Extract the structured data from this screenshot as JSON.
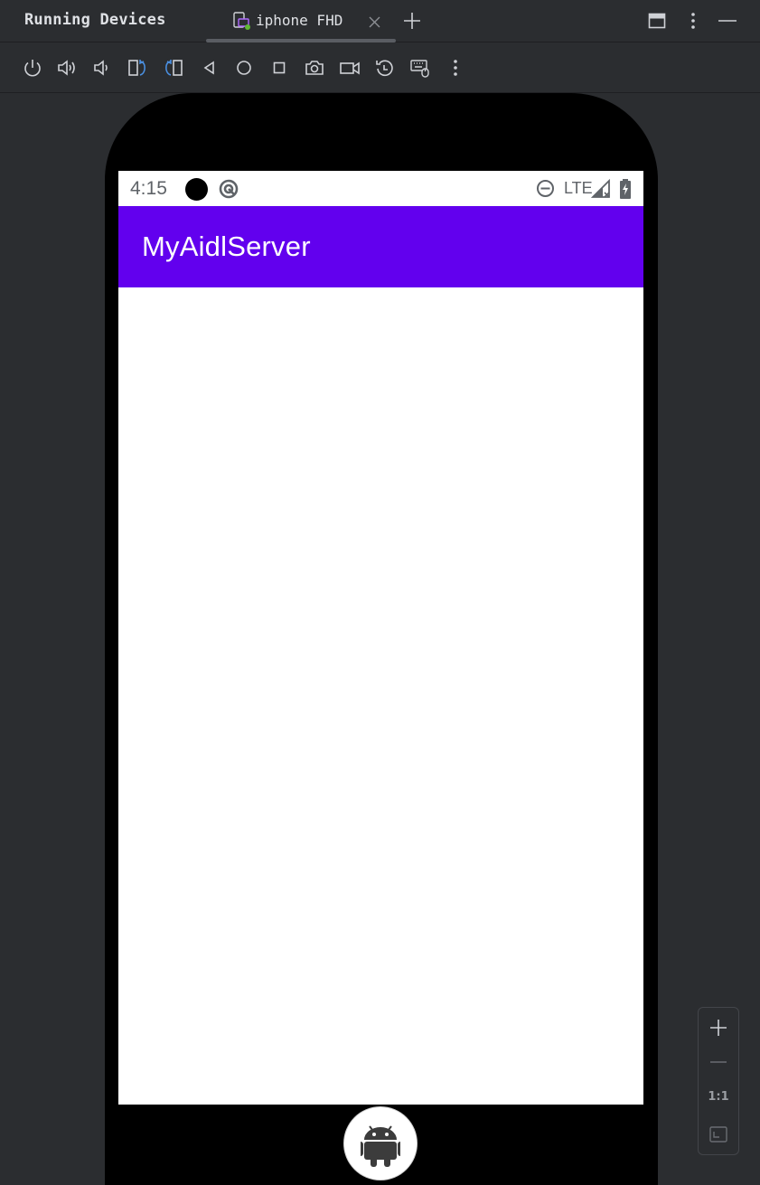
{
  "panel": {
    "title": "Running Devices"
  },
  "tabs": [
    {
      "label": "iphone FHD",
      "status_color": "#5fb832"
    }
  ],
  "toolbar": {
    "buttons": [
      "power-icon",
      "volume-up-icon",
      "volume-down-icon",
      "rotate-left-icon",
      "rotate-right-icon",
      "back-icon",
      "home-icon",
      "overview-icon",
      "screenshot-icon",
      "screen-record-icon",
      "reset-icon",
      "keyboard-mouse-icon",
      "more-vertical-icon"
    ]
  },
  "device": {
    "status_bar": {
      "time": "4:15",
      "network": "LTE"
    },
    "app": {
      "title": "MyAidlServer",
      "accent": "#6200ee"
    }
  },
  "zoom": {
    "actual_size_label": "1:1"
  }
}
